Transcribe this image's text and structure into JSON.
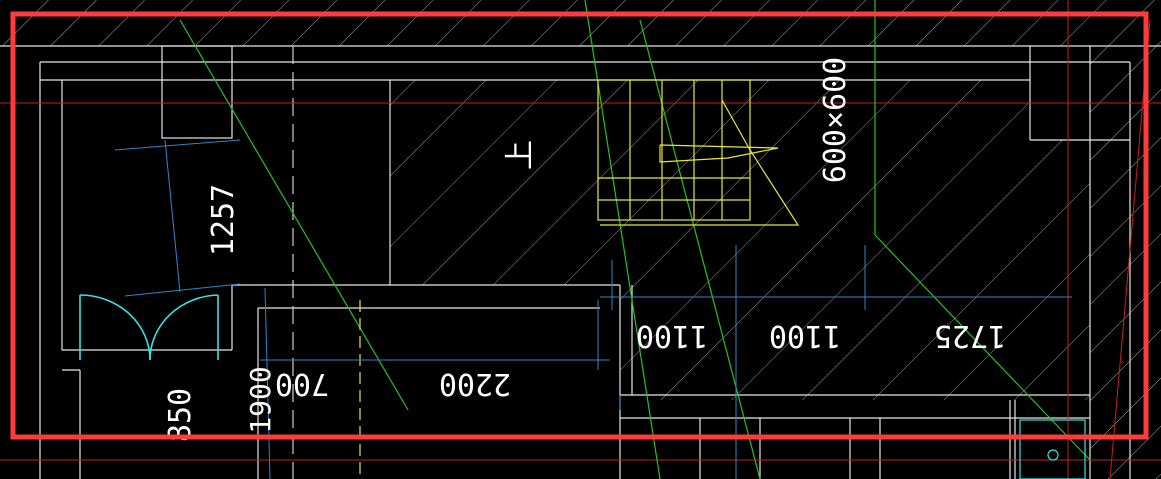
{
  "drawing": {
    "dimensions": {
      "d1257": "1257",
      "d1100a": "1100",
      "d1100b": "1100",
      "d1725": "1725",
      "d2200": "2200",
      "d700": "700",
      "d1900": "1900",
      "d850": "850",
      "tile_note": "600×600",
      "stair_up": "上"
    },
    "colors": {
      "background": "#000000",
      "wall": "#e6e6e6",
      "dimension": "#2f86c8",
      "stair": "#e8e832",
      "axis_green": "#22c322",
      "axis_red": "#c81e1e",
      "door": "#2ee6e6",
      "highlight": "#ff3b3b"
    }
  }
}
